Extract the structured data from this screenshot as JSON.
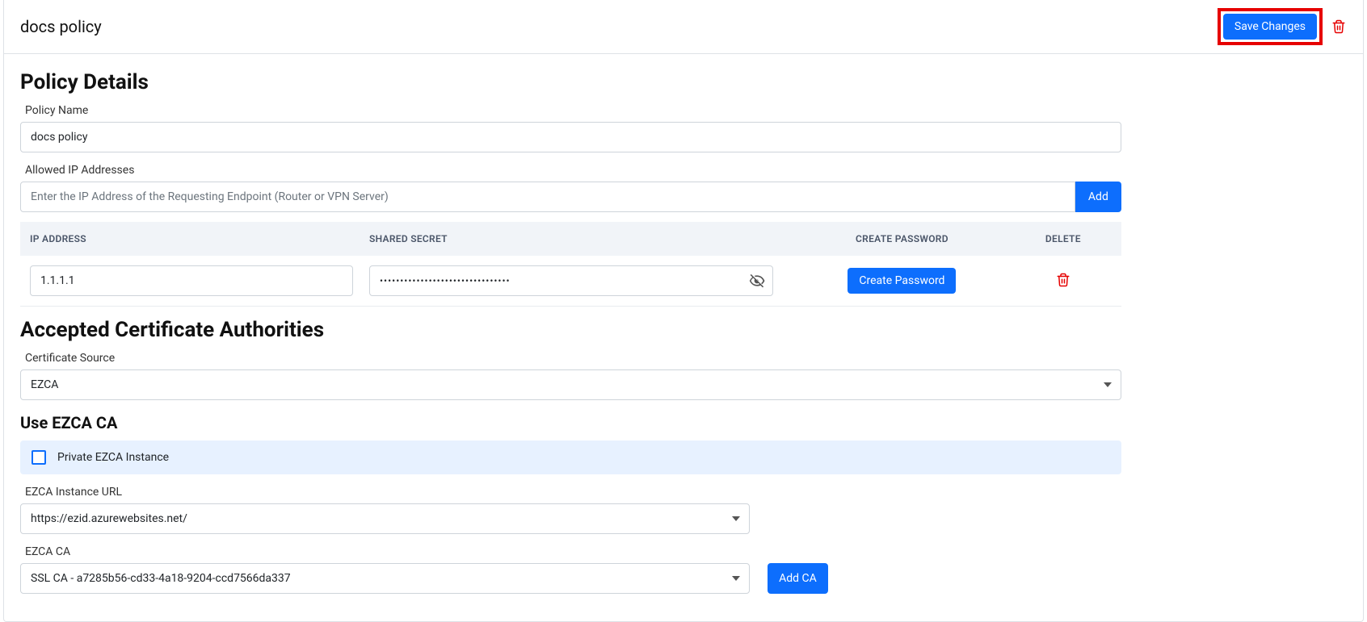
{
  "header": {
    "title": "docs policy",
    "save_button": "Save Changes"
  },
  "policy_details": {
    "heading": "Policy Details",
    "name_label": "Policy Name",
    "name_value": "docs policy",
    "ip_label": "Allowed IP Addresses",
    "ip_placeholder": "Enter the IP Address of the Requesting Endpoint (Router or VPN Server)",
    "add_button": "Add",
    "table": {
      "col_ip": "IP ADDRESS",
      "col_secret": "SHARED SECRET",
      "col_pw": "CREATE PASSWORD",
      "col_del": "DELETE",
      "rows": [
        {
          "ip": "1.1.1.1",
          "secret": "••••••••••••••••••••••••••••••••",
          "create_pw": "Create Password"
        }
      ]
    }
  },
  "cert_auth": {
    "heading": "Accepted Certificate Authorities",
    "source_label": "Certificate Source",
    "source_value": "EZCA",
    "use_heading": "Use EZCA CA",
    "private_checkbox": "Private EZCA Instance",
    "instance_url_label": "EZCA Instance URL",
    "instance_url_value": "https://ezid.azurewebsites.net/",
    "ca_label": "EZCA CA",
    "ca_value": "SSL CA - a7285b56-cd33-4a18-9204-ccd7566da337",
    "add_ca_button": "Add CA"
  }
}
